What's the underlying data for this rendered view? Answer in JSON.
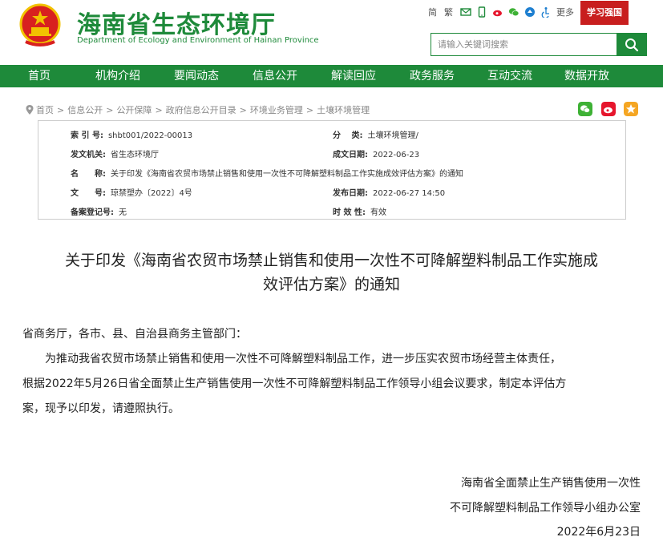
{
  "header": {
    "site_title": "海南省生态环境厅",
    "site_subtitle": "Department of Ecology and Environment of Hainan Province",
    "toplinks": {
      "simplified": "简",
      "traditional": "繁",
      "more": "更多"
    },
    "xuexi_label": "学习强国",
    "search_placeholder": "请输入关键词搜索"
  },
  "nav": [
    "首页",
    "机构介绍",
    "要闻动态",
    "信息公开",
    "解读回应",
    "政务服务",
    "互动交流",
    "数据开放"
  ],
  "breadcrumb": [
    "首页",
    "信息公开",
    "公开保障",
    "政府信息公开目录",
    "环境业务管理",
    "土壤环境管理"
  ],
  "info": {
    "index_key": "索 引 号:",
    "index_val": "shbt001/2022-00013",
    "category_key": "分　 类:",
    "category_val": "土壤环境管理/",
    "issuer_key": "发文机关:",
    "issuer_val": "省生态环境厅",
    "created_key": "成文日期:",
    "created_val": "2022-06-23",
    "name_key": "名　　称:",
    "name_val": "关于印发《海南省农贸市场禁止销售和使用一次性不可降解塑料制品工作实施成效评估方案》的通知",
    "docno_key": "文　　号:",
    "docno_val": "琼禁塑办〔2022〕4号",
    "published_key": "发布日期:",
    "published_val": "2022-06-27 14:50",
    "record_key": "备案登记号:",
    "record_val": "无",
    "validity_key": "时 效 性:",
    "validity_val": "有效"
  },
  "article": {
    "title_line1": "关于印发《海南省农贸市场禁止销售和使用一次性不可降解塑料制品工作实施成",
    "title_line2": "效评估方案》的通知",
    "salutation": "省商务厅，各市、县、自治县商务主管部门：",
    "para_line1": "　　为推动我省农贸市场禁止销售和使用一次性不可降解塑料制品工作，进一步压实农贸市场经营主体责任，",
    "para_line2": "根据2022年5月26日省全面禁止生产销售使用一次性不可降解塑料制品工作领导小组会议要求，制定本评估方",
    "para_line3": "案，现予以印发，请遵照执行。",
    "sign_line1": "海南省全面禁止生产销售使用一次性",
    "sign_line2": "不可降解塑料制品工作领导小组办公室",
    "sign_date": "2022年6月23日"
  },
  "colors": {
    "brand_green": "#1e8a3a",
    "emblem_red": "#d8201f",
    "emblem_gold": "#f2c200",
    "wechat_green": "#3eb135",
    "weibo_red": "#e6162d",
    "favorite_orange": "#f5a623"
  }
}
